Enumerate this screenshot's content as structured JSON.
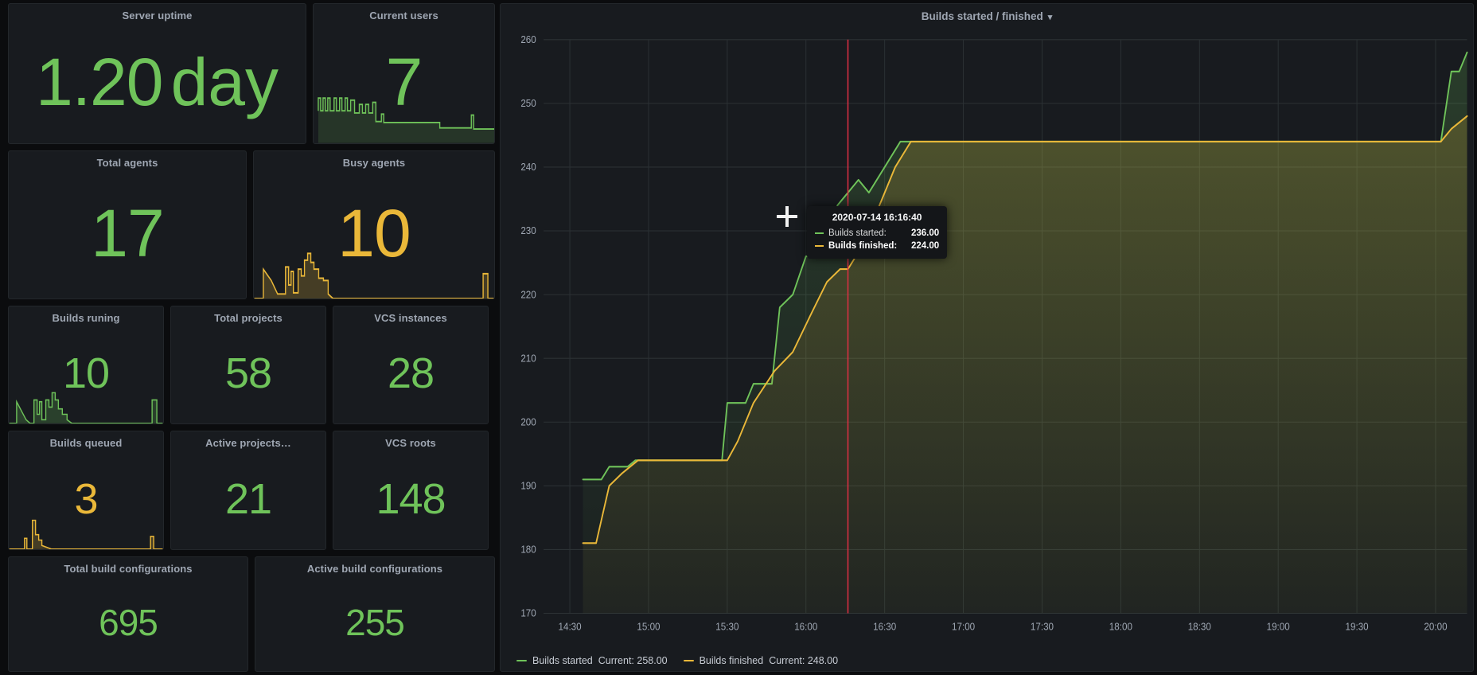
{
  "theme": {
    "bg": "#0b0c0e",
    "panel_bg": "#181b1f",
    "green": "#6fc35a",
    "yellow": "#eab839",
    "title_color": "#9fa7b3",
    "crosshair_color": "#e02f44"
  },
  "stats": [
    {
      "title": "Server uptime",
      "value": "1.20",
      "unit": "day",
      "color": "green",
      "sparkline": false
    },
    {
      "title": "Current users",
      "value": "7",
      "unit": "",
      "color": "green",
      "sparkline": true
    },
    {
      "title": "Total agents",
      "value": "17",
      "unit": "",
      "color": "green",
      "sparkline": false
    },
    {
      "title": "Busy agents",
      "value": "10",
      "unit": "",
      "color": "yellow",
      "sparkline": true
    },
    {
      "title": "Builds runing",
      "value": "10",
      "unit": "",
      "color": "green",
      "sparkline": true
    },
    {
      "title": "Total projects",
      "value": "58",
      "unit": "",
      "color": "green",
      "sparkline": false
    },
    {
      "title": "VCS instances",
      "value": "28",
      "unit": "",
      "color": "green",
      "sparkline": false
    },
    {
      "title": "Builds queued",
      "value": "3",
      "unit": "",
      "color": "yellow",
      "sparkline": true
    },
    {
      "title": "Active projects…",
      "value": "21",
      "unit": "",
      "color": "green",
      "sparkline": false
    },
    {
      "title": "VCS roots",
      "value": "148",
      "unit": "",
      "color": "green",
      "sparkline": false
    },
    {
      "title": "Total build configurations",
      "value": "695",
      "unit": "",
      "color": "green",
      "sparkline": false
    },
    {
      "title": "Active build configurations",
      "value": "255",
      "unit": "",
      "color": "green",
      "sparkline": false
    }
  ],
  "graph": {
    "title": "Builds started / finished",
    "menu_icon": "chevron-down-icon",
    "legend": [
      {
        "name": "Builds started",
        "current_label": "Current: 258.00",
        "color": "#6fc35a"
      },
      {
        "name": "Builds finished",
        "current_label": "Current: 248.00",
        "color": "#eab839"
      }
    ],
    "tooltip": {
      "time": "2020-07-14 16:16:40",
      "rows": [
        {
          "label": "Builds started:",
          "value": "236.00",
          "color": "#6fc35a",
          "highlight": false
        },
        {
          "label": "Builds finished:",
          "value": "224.00",
          "color": "#eab839",
          "highlight": true
        }
      ]
    }
  },
  "chart_data": {
    "type": "line",
    "title": "Builds started / finished",
    "xlabel": "",
    "ylabel": "",
    "ylim": [
      170,
      260
    ],
    "y_ticks": [
      170,
      180,
      190,
      200,
      210,
      220,
      230,
      240,
      250,
      260
    ],
    "x_ticks": [
      "14:30",
      "15:00",
      "15:30",
      "16:00",
      "16:30",
      "17:00",
      "17:30",
      "18:00",
      "18:30",
      "19:00",
      "19:30",
      "20:00"
    ],
    "xlim": [
      "14:20",
      "20:12"
    ],
    "grid": true,
    "legend_position": "bottom-left",
    "fill": "area",
    "series": [
      {
        "name": "Builds started",
        "color": "#6fc35a",
        "current": 258.0,
        "points": [
          {
            "t": "14:35",
            "v": 191
          },
          {
            "t": "14:42",
            "v": 191
          },
          {
            "t": "14:45",
            "v": 193
          },
          {
            "t": "14:52",
            "v": 193
          },
          {
            "t": "14:55",
            "v": 194
          },
          {
            "t": "15:28",
            "v": 194
          },
          {
            "t": "15:30",
            "v": 203
          },
          {
            "t": "15:37",
            "v": 203
          },
          {
            "t": "15:40",
            "v": 206
          },
          {
            "t": "15:47",
            "v": 206
          },
          {
            "t": "15:50",
            "v": 218
          },
          {
            "t": "15:55",
            "v": 220
          },
          {
            "t": "16:00",
            "v": 226
          },
          {
            "t": "16:08",
            "v": 226
          },
          {
            "t": "16:12",
            "v": 234
          },
          {
            "t": "16:16",
            "v": 236
          },
          {
            "t": "16:20",
            "v": 238
          },
          {
            "t": "16:24",
            "v": 236
          },
          {
            "t": "16:30",
            "v": 240
          },
          {
            "t": "16:36",
            "v": 244
          },
          {
            "t": "16:42",
            "v": 244
          },
          {
            "t": "20:02",
            "v": 244
          },
          {
            "t": "20:06",
            "v": 255
          },
          {
            "t": "20:09",
            "v": 255
          },
          {
            "t": "20:12",
            "v": 258
          }
        ]
      },
      {
        "name": "Builds finished",
        "color": "#eab839",
        "current": 248.0,
        "points": [
          {
            "t": "14:35",
            "v": 181
          },
          {
            "t": "14:40",
            "v": 181
          },
          {
            "t": "14:45",
            "v": 190
          },
          {
            "t": "14:50",
            "v": 192
          },
          {
            "t": "14:56",
            "v": 194
          },
          {
            "t": "15:30",
            "v": 194
          },
          {
            "t": "15:34",
            "v": 197
          },
          {
            "t": "15:40",
            "v": 203
          },
          {
            "t": "15:48",
            "v": 208
          },
          {
            "t": "15:55",
            "v": 211
          },
          {
            "t": "16:02",
            "v": 217
          },
          {
            "t": "16:08",
            "v": 222
          },
          {
            "t": "16:13",
            "v": 224
          },
          {
            "t": "16:16",
            "v": 224
          },
          {
            "t": "16:22",
            "v": 228
          },
          {
            "t": "16:28",
            "v": 234
          },
          {
            "t": "16:34",
            "v": 240
          },
          {
            "t": "16:40",
            "v": 244
          },
          {
            "t": "16:46",
            "v": 244
          },
          {
            "t": "20:02",
            "v": 244
          },
          {
            "t": "20:06",
            "v": 246
          },
          {
            "t": "20:12",
            "v": 248
          }
        ]
      }
    ],
    "annotations": [
      {
        "type": "crosshair-vline",
        "t": "16:16:40",
        "color": "#e02f44"
      }
    ]
  }
}
